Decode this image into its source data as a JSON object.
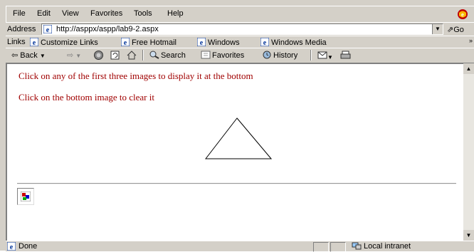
{
  "menubar": {
    "items": [
      {
        "label": "File"
      },
      {
        "label": "Edit"
      },
      {
        "label": "View"
      },
      {
        "label": "Favorites"
      },
      {
        "label": "Tools"
      },
      {
        "label": "Help"
      }
    ]
  },
  "address": {
    "label": "Address",
    "url": "http://asppx/aspp/lab9-2.aspx",
    "go": "Go"
  },
  "links": {
    "label": "Links",
    "items": [
      {
        "label": "Customize Links"
      },
      {
        "label": "Free Hotmail"
      },
      {
        "label": "Windows"
      },
      {
        "label": "Windows Media"
      }
    ]
  },
  "toolbar": {
    "back": "Back",
    "search": "Search",
    "favorites": "Favorites",
    "history": "History"
  },
  "page": {
    "line1": "Click on any of the first three images to display it at the bottom",
    "line2": "Click on the bottom image to clear it"
  },
  "status": {
    "text": "Done",
    "zone": "Local intranet"
  },
  "colors": {
    "text_accent": "#a00000",
    "chrome": "#d4d0c8"
  }
}
